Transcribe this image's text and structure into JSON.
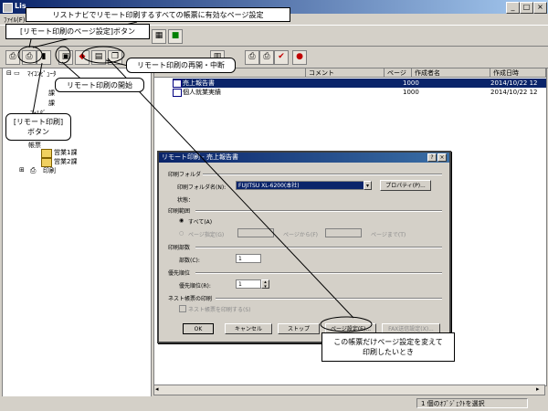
{
  "window": {
    "title": "Lis",
    "menu_first": "ﾌｧｲﾙ(F)",
    "controls": [
      "_",
      "□",
      "×"
    ]
  },
  "callouts": {
    "top_banner": "リストナビでリモート印刷するすべての帳票に有効なページ設定",
    "page_setup_button": "[リモート印刷のページ設定]ボタン",
    "resume_stop": "リモート印刷の再開・中断",
    "start": "リモート印刷の開始",
    "remote_print_button": "[リモート印刷]\nボタン",
    "per_form": "この帳票だけページ設定を変えて\n印刷したいとき"
  },
  "tree": {
    "root": "ﾏｲｺﾝﾋﾟｭｰﾀ",
    "items": [
      "営業1課",
      "営業2課",
      "印刷"
    ],
    "partial": [
      "課",
      "課",
      "ﾌｫﾙﾀﾞ",
      "帳票"
    ]
  },
  "list": {
    "headers": [
      "コメント",
      "ページ数",
      "作成者名",
      "作成日時"
    ],
    "rows": [
      {
        "name": "売上報告書",
        "pages": "1000",
        "date": "2014/10/22 12"
      },
      {
        "name": "個人就業実績",
        "pages": "1000",
        "date": "2014/10/22 12"
      }
    ]
  },
  "status": {
    "selection": "1 個のｵﾌﾞｼﾞｪｸﾄを選択"
  },
  "dialog": {
    "title": "リモート印刷 - 売上報告書",
    "title_buttons": [
      "?",
      "×"
    ],
    "printer_group": "印刷フォルダ",
    "printer_label": "印刷フォルダ名(N):",
    "printer_value": "FUJITSU XL-6200(本社)",
    "properties": "プロパティ(P)...",
    "state_label": "状態：",
    "range_group": "印刷範囲",
    "range_all": "すべて(A)",
    "range_pages": "ページ指定(G)",
    "range_from": "ページから(F)",
    "range_to": "ページまで(T)",
    "copies_group": "印刷部数",
    "copies_label": "部数(C):",
    "copies_value": "1",
    "priority_group": "優先順位",
    "priority_label": "優先順位(R):",
    "priority_value": "1",
    "next_group": "ネスト帳票の印刷",
    "next_check": "ネスト帳票を印刷する(S)",
    "buttons": [
      "OK",
      "キャンセル",
      "ストップ",
      "ページ設定(E)...",
      "FAX送信設定(X)..."
    ]
  }
}
